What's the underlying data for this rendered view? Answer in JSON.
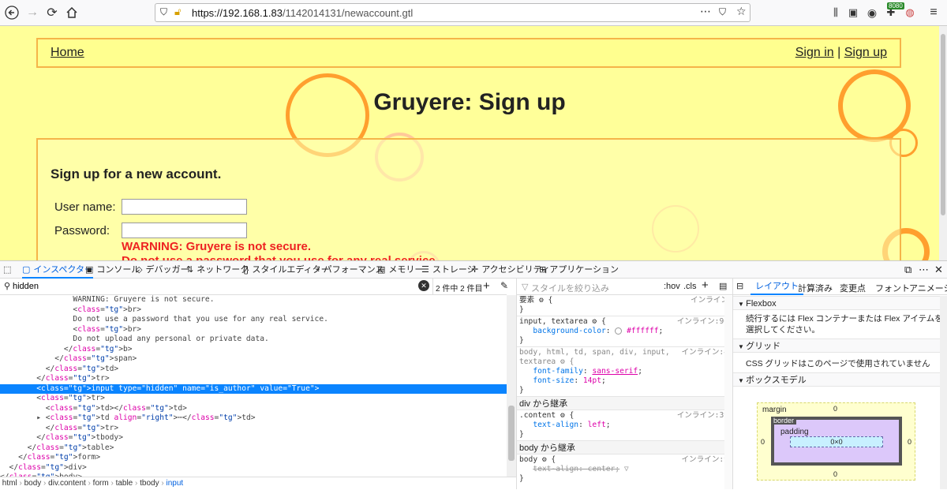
{
  "browser": {
    "url_host": "https://192.168.1.83",
    "url_path": "/1142014131/newaccount.gtl",
    "badge": "8080"
  },
  "page": {
    "nav": {
      "home": "Home",
      "sign_in": "Sign in",
      "sep": "|",
      "sign_up": "Sign up"
    },
    "title": "Gruyere: Sign up",
    "heading": "Sign up for a new account.",
    "username_label": "User name:",
    "password_label": "Password:",
    "warning1": "WARNING: Gruyere is not secure.",
    "warning2": "Do not use a password that you use for any real service."
  },
  "devtools": {
    "tabs": [
      "インスペクター",
      "コンソール",
      "デバッガー",
      "ネットワーク",
      "スタイルエディター",
      "パフォーマンス",
      "メモリー",
      "ストレージ",
      "アクセシビリティ",
      "アプリケーション"
    ],
    "search_value": "hidden",
    "search_count": "2 件中 2 件目",
    "filter_placeholder": "スタイルを絞り込み",
    "hov": ":hov",
    "cls": ".cls",
    "layout_tabs": [
      "レイアウト",
      "計算済み",
      "変更点",
      "フォント",
      "アニメーシ"
    ],
    "breadcrumb": [
      "html",
      "body",
      "div.content",
      "form",
      "table",
      "tbody",
      "input"
    ],
    "inherit_div": "div から継承",
    "inherit_body": "body から継承",
    "flexbox_title": "Flexbox",
    "flexbox_msg": "続行するには Flex コンテナーまたは Flex アイテムを選択してください。",
    "grid_title": "グリッド",
    "grid_msg": "CSS グリッドはこのページで使用されていません",
    "boxmodel_title": "ボックスモデル",
    "bm_margin": "margin",
    "bm_border": "border",
    "bm_padding": "padding",
    "bm_content": "0×0",
    "bm_zero": "0",
    "code_lines": [
      "                WARNING: Gruyere is not secure.",
      "                <br>",
      "                Do not use a password that you use for any real service.",
      "                <br>",
      "                Do not upload any personal or private data.",
      "              </b>",
      "            </span>",
      "          </td>",
      "        </tr>",
      "        <input type=\"hidden\" name=\"is_author\" value=\"True\">",
      "        <tr>",
      "          <td></td>",
      "        ▸ <td align=\"right\">⋯</td>",
      "          </tr>",
      "        </tbody>",
      "      </table>",
      "    </form>",
      "  </div>",
      "</body>"
    ],
    "rules": {
      "elem": "要素 ⚙ {",
      "inline": "インライン",
      "r1_sel": "input, textarea ⚙ {",
      "r1_src": "インライン:96",
      "r1_prop": "background-color",
      "r1_val": "#ffffff",
      "r2_sel1": "body, html, td, span, div, input,",
      "r2_sel2": "textarea ⚙ {",
      "r2_src": "インライン:4",
      "r2_p1": "font-family",
      "r2_v1": "sans-serif",
      "r2_p2": "font-size",
      "r2_v2": "14pt",
      "r3_sel": ".content ⚙ {",
      "r3_src": "インライン:39",
      "r3_p": "text-align",
      "r3_v": "left",
      "r4_sel": "body ⚙ {",
      "r4_src": "インライン:9",
      "r4_p": "text-align",
      "r4_v": "center",
      "close": "}"
    }
  }
}
